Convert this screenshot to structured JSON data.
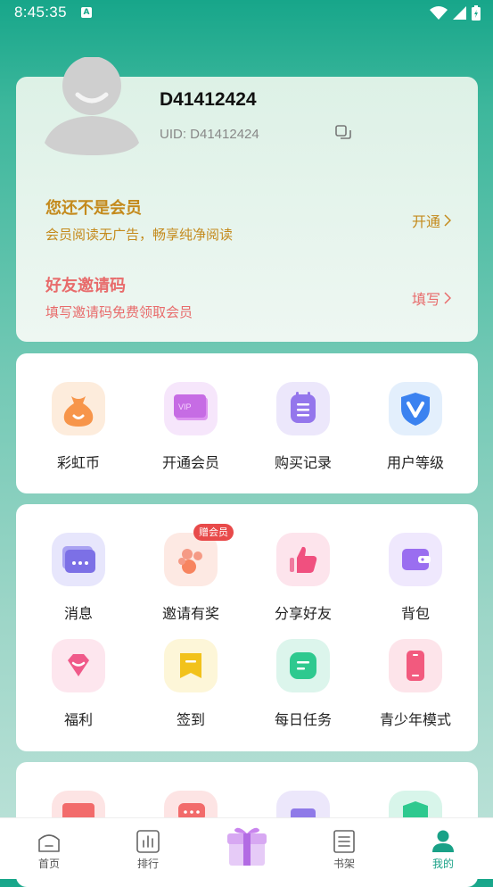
{
  "status_bar": {
    "time": "8:45:35",
    "notification_letter": "A"
  },
  "profile": {
    "username": "D41412424",
    "uid": "UID: D41412424",
    "vip_title": "您还不是会员",
    "vip_subtitle": "会员阅读无广告，畅享纯净阅读",
    "vip_action": "开通",
    "invite_title": "好友邀请码",
    "invite_subtitle": "填写邀请码免费领取会员",
    "invite_action": "填写"
  },
  "card1": {
    "items": [
      {
        "label": "彩虹币",
        "icon": "money-bag-icon"
      },
      {
        "label": "开通会员",
        "icon": "vip-card-icon"
      },
      {
        "label": "购买记录",
        "icon": "purchase-record-icon"
      },
      {
        "label": "用户等级",
        "icon": "shield-v-icon"
      }
    ]
  },
  "card2": {
    "badge": "赠会员",
    "items": [
      {
        "label": "消息",
        "icon": "message-icon"
      },
      {
        "label": "邀请有奖",
        "icon": "invite-reward-icon"
      },
      {
        "label": "分享好友",
        "icon": "thumbs-up-icon"
      },
      {
        "label": "背包",
        "icon": "wallet-icon"
      },
      {
        "label": "福利",
        "icon": "gem-icon"
      },
      {
        "label": "签到",
        "icon": "bookmark-icon"
      },
      {
        "label": "每日任务",
        "icon": "daily-task-icon"
      },
      {
        "label": "青少年模式",
        "icon": "phone-icon"
      }
    ]
  },
  "bottom_nav": {
    "items": [
      {
        "label": "首页",
        "icon": "home-icon"
      },
      {
        "label": "排行",
        "icon": "ranking-icon"
      },
      {
        "label": "书架",
        "icon": "bookshelf-icon"
      },
      {
        "label": "我的",
        "icon": "profile-icon"
      }
    ],
    "active": "我的"
  },
  "colors": {
    "accent": "#19a187",
    "vip": "#c48a1c",
    "invite": "#e86b6b",
    "badge": "#e84a4a"
  }
}
